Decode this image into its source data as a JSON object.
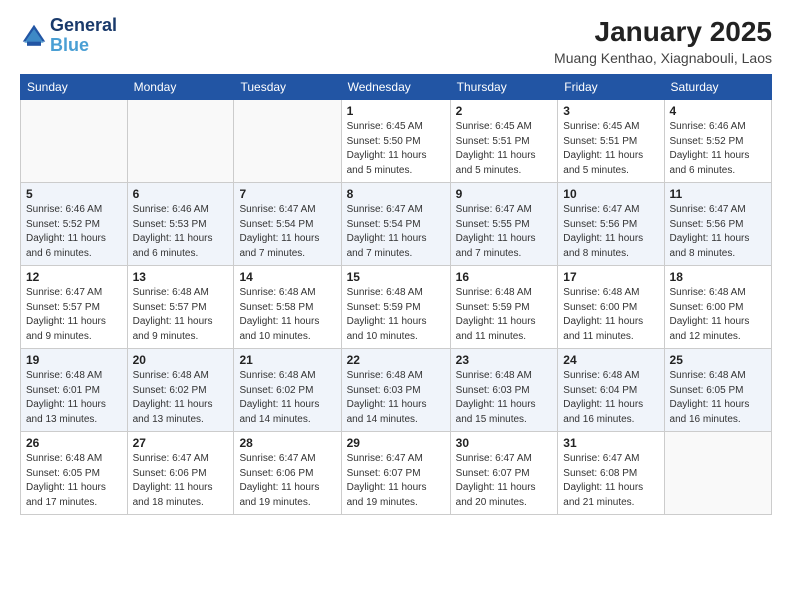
{
  "header": {
    "logo_line1": "General",
    "logo_line2": "Blue",
    "month_title": "January 2025",
    "subtitle": "Muang Kenthao, Xiagnabouli, Laos"
  },
  "days_of_week": [
    "Sunday",
    "Monday",
    "Tuesday",
    "Wednesday",
    "Thursday",
    "Friday",
    "Saturday"
  ],
  "weeks": [
    [
      {
        "day": "",
        "info": ""
      },
      {
        "day": "",
        "info": ""
      },
      {
        "day": "",
        "info": ""
      },
      {
        "day": "1",
        "info": "Sunrise: 6:45 AM\nSunset: 5:50 PM\nDaylight: 11 hours\nand 5 minutes."
      },
      {
        "day": "2",
        "info": "Sunrise: 6:45 AM\nSunset: 5:51 PM\nDaylight: 11 hours\nand 5 minutes."
      },
      {
        "day": "3",
        "info": "Sunrise: 6:45 AM\nSunset: 5:51 PM\nDaylight: 11 hours\nand 5 minutes."
      },
      {
        "day": "4",
        "info": "Sunrise: 6:46 AM\nSunset: 5:52 PM\nDaylight: 11 hours\nand 6 minutes."
      }
    ],
    [
      {
        "day": "5",
        "info": "Sunrise: 6:46 AM\nSunset: 5:52 PM\nDaylight: 11 hours\nand 6 minutes."
      },
      {
        "day": "6",
        "info": "Sunrise: 6:46 AM\nSunset: 5:53 PM\nDaylight: 11 hours\nand 6 minutes."
      },
      {
        "day": "7",
        "info": "Sunrise: 6:47 AM\nSunset: 5:54 PM\nDaylight: 11 hours\nand 7 minutes."
      },
      {
        "day": "8",
        "info": "Sunrise: 6:47 AM\nSunset: 5:54 PM\nDaylight: 11 hours\nand 7 minutes."
      },
      {
        "day": "9",
        "info": "Sunrise: 6:47 AM\nSunset: 5:55 PM\nDaylight: 11 hours\nand 7 minutes."
      },
      {
        "day": "10",
        "info": "Sunrise: 6:47 AM\nSunset: 5:56 PM\nDaylight: 11 hours\nand 8 minutes."
      },
      {
        "day": "11",
        "info": "Sunrise: 6:47 AM\nSunset: 5:56 PM\nDaylight: 11 hours\nand 8 minutes."
      }
    ],
    [
      {
        "day": "12",
        "info": "Sunrise: 6:47 AM\nSunset: 5:57 PM\nDaylight: 11 hours\nand 9 minutes."
      },
      {
        "day": "13",
        "info": "Sunrise: 6:48 AM\nSunset: 5:57 PM\nDaylight: 11 hours\nand 9 minutes."
      },
      {
        "day": "14",
        "info": "Sunrise: 6:48 AM\nSunset: 5:58 PM\nDaylight: 11 hours\nand 10 minutes."
      },
      {
        "day": "15",
        "info": "Sunrise: 6:48 AM\nSunset: 5:59 PM\nDaylight: 11 hours\nand 10 minutes."
      },
      {
        "day": "16",
        "info": "Sunrise: 6:48 AM\nSunset: 5:59 PM\nDaylight: 11 hours\nand 11 minutes."
      },
      {
        "day": "17",
        "info": "Sunrise: 6:48 AM\nSunset: 6:00 PM\nDaylight: 11 hours\nand 11 minutes."
      },
      {
        "day": "18",
        "info": "Sunrise: 6:48 AM\nSunset: 6:00 PM\nDaylight: 11 hours\nand 12 minutes."
      }
    ],
    [
      {
        "day": "19",
        "info": "Sunrise: 6:48 AM\nSunset: 6:01 PM\nDaylight: 11 hours\nand 13 minutes."
      },
      {
        "day": "20",
        "info": "Sunrise: 6:48 AM\nSunset: 6:02 PM\nDaylight: 11 hours\nand 13 minutes."
      },
      {
        "day": "21",
        "info": "Sunrise: 6:48 AM\nSunset: 6:02 PM\nDaylight: 11 hours\nand 14 minutes."
      },
      {
        "day": "22",
        "info": "Sunrise: 6:48 AM\nSunset: 6:03 PM\nDaylight: 11 hours\nand 14 minutes."
      },
      {
        "day": "23",
        "info": "Sunrise: 6:48 AM\nSunset: 6:03 PM\nDaylight: 11 hours\nand 15 minutes."
      },
      {
        "day": "24",
        "info": "Sunrise: 6:48 AM\nSunset: 6:04 PM\nDaylight: 11 hours\nand 16 minutes."
      },
      {
        "day": "25",
        "info": "Sunrise: 6:48 AM\nSunset: 6:05 PM\nDaylight: 11 hours\nand 16 minutes."
      }
    ],
    [
      {
        "day": "26",
        "info": "Sunrise: 6:48 AM\nSunset: 6:05 PM\nDaylight: 11 hours\nand 17 minutes."
      },
      {
        "day": "27",
        "info": "Sunrise: 6:47 AM\nSunset: 6:06 PM\nDaylight: 11 hours\nand 18 minutes."
      },
      {
        "day": "28",
        "info": "Sunrise: 6:47 AM\nSunset: 6:06 PM\nDaylight: 11 hours\nand 19 minutes."
      },
      {
        "day": "29",
        "info": "Sunrise: 6:47 AM\nSunset: 6:07 PM\nDaylight: 11 hours\nand 19 minutes."
      },
      {
        "day": "30",
        "info": "Sunrise: 6:47 AM\nSunset: 6:07 PM\nDaylight: 11 hours\nand 20 minutes."
      },
      {
        "day": "31",
        "info": "Sunrise: 6:47 AM\nSunset: 6:08 PM\nDaylight: 11 hours\nand 21 minutes."
      },
      {
        "day": "",
        "info": ""
      }
    ]
  ]
}
